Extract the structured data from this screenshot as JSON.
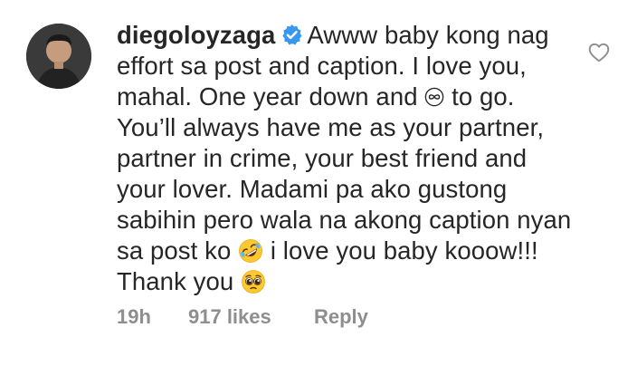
{
  "comment": {
    "username": "diegoloyzaga",
    "text_parts": [
      "Awww baby kong nag effort sa post and caption. I love you, mahal. One year down and ",
      " to go. You’ll always have me as your partner, partner in crime, your best friend and your lover. Madami pa ako gustong sabihin pero wala na akong caption nyan sa post ko ",
      " i love you baby kooow!!! Thank you "
    ],
    "icons": {
      "verified": "verified-badge-icon",
      "infinity": "infinity-icon",
      "emoji_1": "rolling-laughing-emoji-icon",
      "emoji_2": "pleading-face-emoji-icon",
      "like": "heart-outline-icon"
    },
    "meta": {
      "time": "19h",
      "likes": "917 likes",
      "reply": "Reply"
    }
  },
  "colors": {
    "text": "#262626",
    "muted": "#8e8e8e",
    "verified": "#3897f0"
  }
}
